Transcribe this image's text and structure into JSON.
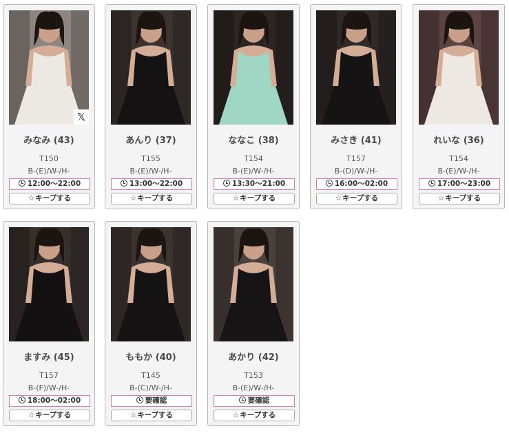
{
  "keep_label": "キープする",
  "star_glyph": "☆",
  "x_logo": "𝕏",
  "cards": [
    {
      "name": "みなみ (43)",
      "height": "T150",
      "size": "B-(E)/W-/H-",
      "schedule": "12:00～22:00",
      "has_x_badge": true,
      "tone": "#8e8580",
      "outfit": "#ece9e2"
    },
    {
      "name": "あんり (37)",
      "height": "T155",
      "size": "B-(E)/W-/H-",
      "schedule": "13:00～22:00",
      "has_x_badge": false,
      "tone": "#3a3330",
      "outfit": "#141212"
    },
    {
      "name": "ななこ (38)",
      "height": "T154",
      "size": "B-(E)/W-/H-",
      "schedule": "13:30～21:00",
      "has_x_badge": false,
      "tone": "#2c2523",
      "outfit": "#9fd6c4"
    },
    {
      "name": "みさき (41)",
      "height": "T157",
      "size": "B-(D)/W-/H-",
      "schedule": "16:00～02:00",
      "has_x_badge": false,
      "tone": "#2f2927",
      "outfit": "#151313"
    },
    {
      "name": "れいな (36)",
      "height": "T154",
      "size": "B-(E)/W-/H-",
      "schedule": "17:00～23:00",
      "has_x_badge": false,
      "tone": "#5a4340",
      "outfit": "#ede8e2"
    },
    {
      "name": "ますみ (45)",
      "height": "T157",
      "size": "B-(F)/W-/H-",
      "schedule": "18:00～02:00",
      "has_x_badge": false,
      "tone": "#362f2c",
      "outfit": "#131111"
    },
    {
      "name": "ももか (40)",
      "height": "T145",
      "size": "B-(C)/W-/H-",
      "schedule": "要確認",
      "has_x_badge": false,
      "tone": "#3b3330",
      "outfit": "#151313"
    },
    {
      "name": "あかり (42)",
      "height": "T153",
      "size": "B-(E)/W-/H-",
      "schedule": "要確認",
      "has_x_badge": false,
      "tone": "#4a403c",
      "outfit": "#161414"
    }
  ]
}
